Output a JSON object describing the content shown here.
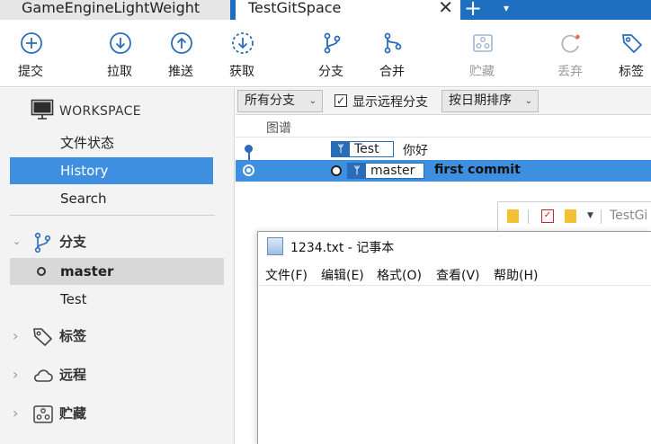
{
  "tabs": [
    {
      "label": "GameEngineLightWeight",
      "active": false
    },
    {
      "label": "TestGitSpace",
      "active": true
    }
  ],
  "tabbar": {
    "close": "✕",
    "new": "+",
    "menu": "▾"
  },
  "toolbar": {
    "items": [
      {
        "label": "提交",
        "icon": "commit-plus-icon"
      },
      {
        "label": "拉取",
        "icon": "pull-down-arrow-icon"
      },
      {
        "label": "推送",
        "icon": "push-up-arrow-icon"
      },
      {
        "label": "获取",
        "icon": "fetch-dashed-arrow-icon"
      },
      {
        "label": "分支",
        "icon": "branch-icon"
      },
      {
        "label": "合并",
        "icon": "merge-icon"
      },
      {
        "label": "贮藏",
        "icon": "stash-icon",
        "disabled": true
      },
      {
        "label": "丢弃",
        "icon": "discard-icon",
        "disabled": true
      },
      {
        "label": "标签",
        "icon": "tag-icon"
      }
    ]
  },
  "sidebar": {
    "workspace_title": "WORKSPACE",
    "workspace_items": [
      {
        "label": "文件状态",
        "active": false
      },
      {
        "label": "History",
        "active": true
      },
      {
        "label": "Search",
        "active": false
      }
    ],
    "branches_title": "分支",
    "branches": [
      {
        "label": "master",
        "current": true
      },
      {
        "label": "Test",
        "current": false
      }
    ],
    "tags_title": "标签",
    "remotes_title": "远程",
    "stashes_title": "贮藏",
    "expanded_chevron": "⌄",
    "collapsed_chevron": "›"
  },
  "filters": {
    "branch_filter": "所有分支",
    "show_remote_label": "显示远程分支",
    "show_remote_checked": true,
    "sort": "按日期排序",
    "caret": "⌄"
  },
  "history": {
    "column_graph": "图谱",
    "commits": [
      {
        "branch": "Test",
        "message": "你好",
        "selected": false
      },
      {
        "branch": "master",
        "message": "first commit",
        "selected": true,
        "head": true
      }
    ]
  },
  "explorer": {
    "title": "TestGi"
  },
  "notepad": {
    "title": "1234.txt - 记事本",
    "menu": [
      "文件(F)",
      "编辑(E)",
      "格式(O)",
      "查看(V)",
      "帮助(H)"
    ]
  },
  "colors": {
    "accent": "#3f8fe0",
    "tabbar": "#1f6fc0",
    "icon": "#2b6cb8"
  }
}
